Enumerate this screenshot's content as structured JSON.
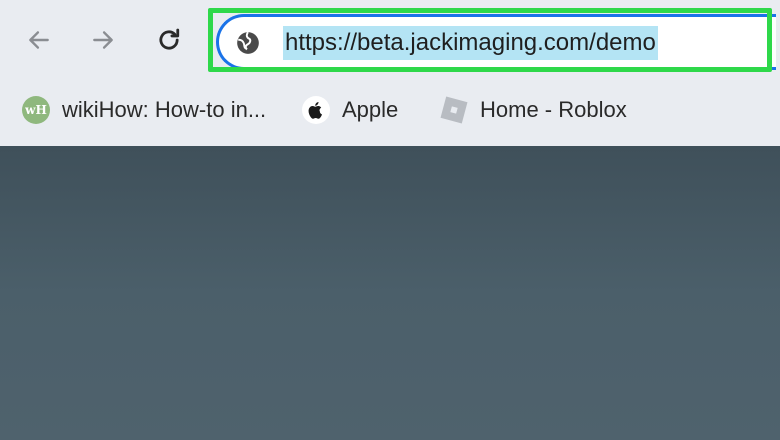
{
  "omnibox": {
    "url": "https://beta.jackimaging.com/demo"
  },
  "bookmarks": [
    {
      "label": "wikiHow: How-to in...",
      "icon": "wikihow-icon",
      "badge": "wH"
    },
    {
      "label": "Apple",
      "icon": "apple-icon"
    },
    {
      "label": "Home - Roblox",
      "icon": "roblox-icon"
    }
  ],
  "colors": {
    "highlight": "#2ed84a",
    "omnibox_focus": "#1a73e8",
    "url_selection": "#b4e4f4",
    "toolbar": "#e9ecf1",
    "page_background": "#4a5d68"
  }
}
